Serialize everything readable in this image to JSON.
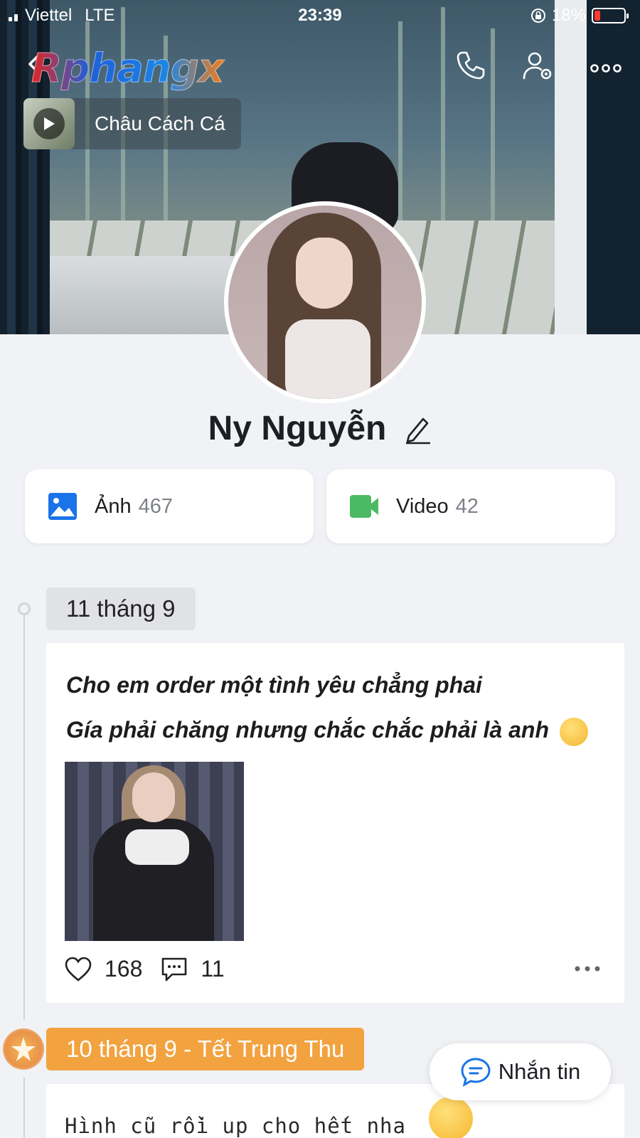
{
  "status_bar": {
    "carrier": "Viettel",
    "network": "LTE",
    "time": "23:39",
    "battery": "18%"
  },
  "header": {
    "logo_text": "Rphangx"
  },
  "music": {
    "title": "Châu Cách Cá"
  },
  "profile": {
    "name": "Ny Nguyễn"
  },
  "media": {
    "photos_label": "Ảnh",
    "photos_count": "467",
    "videos_label": "Video",
    "videos_count": "42"
  },
  "timeline": [
    {
      "date": "11 tháng 9",
      "text_line1": "Cho em order một tình yêu chẳng phai",
      "text_line2": "Gía phải chăng nhưng chắc chắc phải là anh",
      "likes": "168",
      "comments": "11"
    },
    {
      "date": "10 tháng 9 - Tết Trung Thu",
      "text_line1": "Hình cũ rồi up cho hết nha"
    }
  ],
  "message_button": {
    "label": "Nhắn tin"
  },
  "colors": {
    "accent_blue": "#1a73e8",
    "video_green": "#4cb963",
    "festival_orange": "#f2a23f",
    "battery_low": "#ff3b30"
  },
  "icons": {
    "back": "chevron-left-icon",
    "call": "phone-icon",
    "profile_settings": "user-settings-icon",
    "more": "more-horizontal-icon",
    "play": "play-icon",
    "edit": "pencil-icon",
    "photo": "image-icon",
    "video": "video-camera-icon",
    "like": "heart-icon",
    "comment": "comment-icon",
    "message": "chat-bubble-icon"
  }
}
